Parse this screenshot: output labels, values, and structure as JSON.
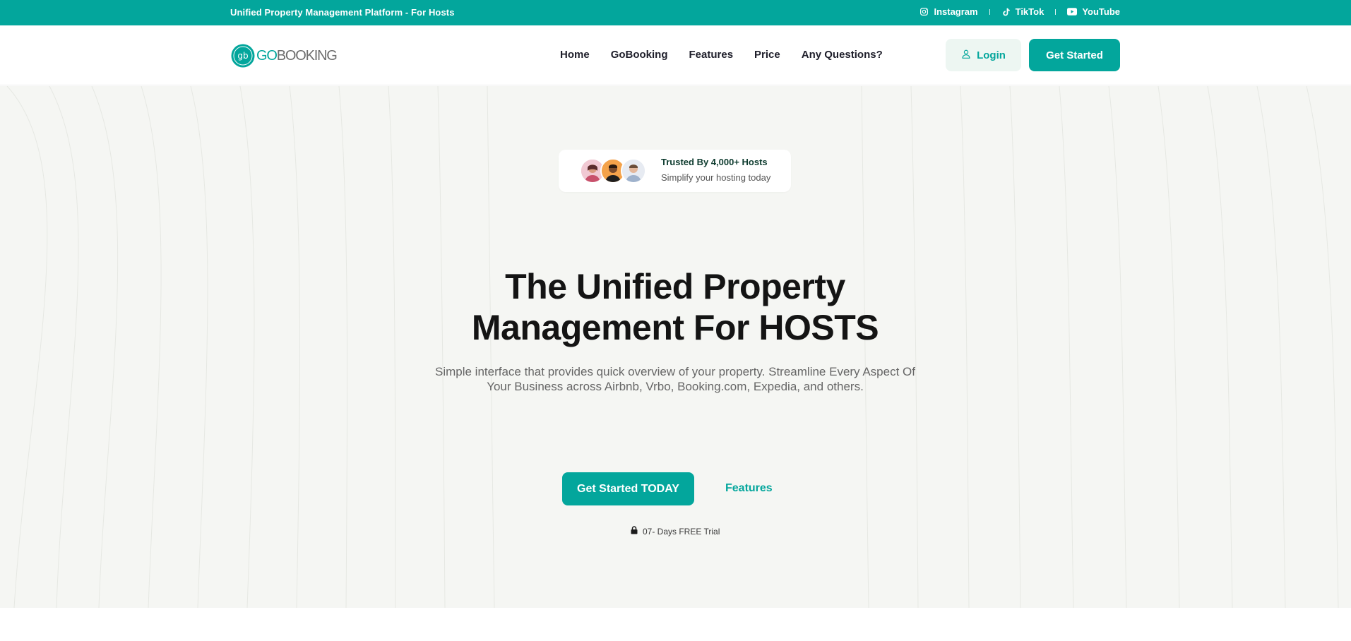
{
  "topbar": {
    "tagline": "Unified Property Management Platform - For Hosts",
    "socials": [
      {
        "label": "Instagram",
        "icon": "instagram-icon"
      },
      {
        "label": "TikTok",
        "icon": "tiktok-icon"
      },
      {
        "label": "YouTube",
        "icon": "youtube-icon"
      }
    ]
  },
  "header": {
    "logo": {
      "prefix": "GO",
      "suffix": "BOOKING",
      "mark": "gb"
    },
    "nav": [
      {
        "label": "Home"
      },
      {
        "label": "GoBooking"
      },
      {
        "label": "Features"
      },
      {
        "label": "Price"
      },
      {
        "label": "Any Questions?"
      }
    ],
    "login_label": "Login",
    "get_started_label": "Get Started"
  },
  "hero": {
    "trusted_title": "Trusted By 4,000+ Hosts",
    "trusted_sub": "Simplify your hosting today",
    "title_line1": "The Unified Property",
    "title_line2": "Management For HOSTS",
    "subtitle_line1": "Simple interface that provides quick overview of your property. Streamline Every Aspect Of",
    "subtitle_line2": "Your Business across Airbnb, Vrbo, Booking.com, Expedia, and others.",
    "cta_label": "Get Started TODAY",
    "features_label": "Features",
    "trial_label": "07- Days FREE Trial"
  },
  "colors": {
    "brand": "#03a69c",
    "hero_bg": "#f5f6f3",
    "login_bg": "#edf6f2"
  }
}
